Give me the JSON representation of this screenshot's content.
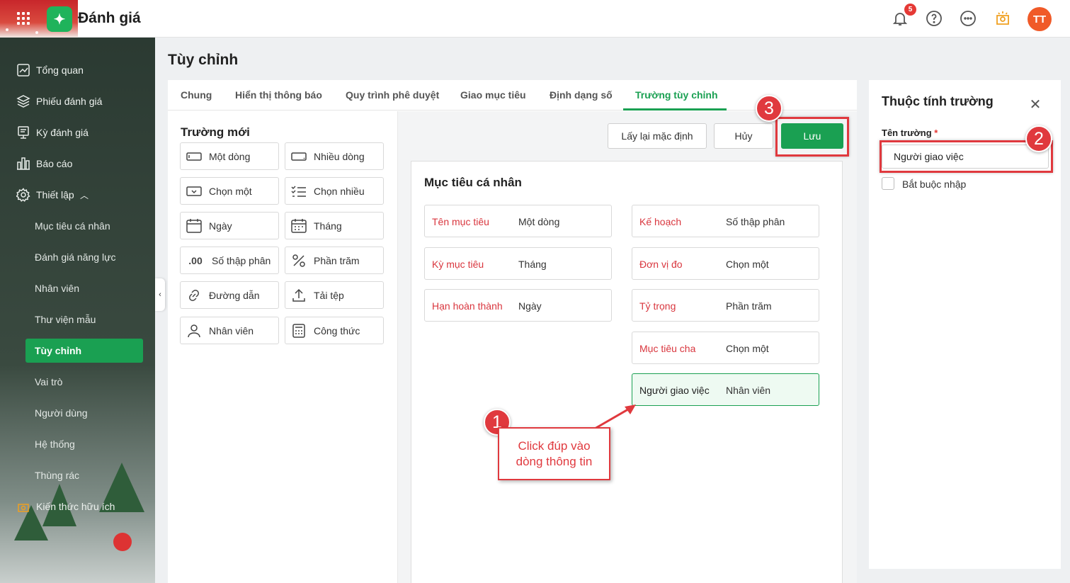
{
  "app": {
    "title": "Đánh giá"
  },
  "header": {
    "notification_count": "5",
    "avatar_initials": "TT"
  },
  "sidebar": {
    "items": [
      {
        "label": "Tổng quan",
        "icon": "chart-icon"
      },
      {
        "label": "Phiếu đánh giá",
        "icon": "layers-icon"
      },
      {
        "label": "Kỳ đánh giá",
        "icon": "period-icon"
      },
      {
        "label": "Báo cáo",
        "icon": "report-icon"
      },
      {
        "label": "Thiết lập",
        "icon": "gear-icon"
      }
    ],
    "sub_items": [
      {
        "label": "Mục tiêu cá nhân"
      },
      {
        "label": "Đánh giá năng lực"
      },
      {
        "label": "Nhân viên"
      },
      {
        "label": "Thư viện mẫu"
      },
      {
        "label": "Tùy chỉnh"
      },
      {
        "label": "Vai trò"
      },
      {
        "label": "Người dùng"
      },
      {
        "label": "Hệ thống"
      },
      {
        "label": "Thùng rác"
      }
    ],
    "bottom_label": "Kiến thức hữu ích"
  },
  "page": {
    "title": "Tùy chỉnh"
  },
  "tabs": [
    {
      "label": "Chung"
    },
    {
      "label": "Hiển thị thông báo"
    },
    {
      "label": "Quy trình phê duyệt"
    },
    {
      "label": "Giao mục tiêu"
    },
    {
      "label": "Định dạng số"
    },
    {
      "label": "Trường tùy chỉnh"
    }
  ],
  "new_fields": {
    "title": "Trường mới",
    "items": [
      {
        "label": "Một dòng",
        "icon": "single-line-icon"
      },
      {
        "label": "Nhiều dòng",
        "icon": "multi-line-icon"
      },
      {
        "label": "Chọn một",
        "icon": "dropdown-icon"
      },
      {
        "label": "Chọn nhiều",
        "icon": "checklist-icon"
      },
      {
        "label": "Ngày",
        "icon": "calendar-icon"
      },
      {
        "label": "Tháng",
        "icon": "calendar-month-icon"
      },
      {
        "label": "Số thập phân",
        "icon": "decimal-icon"
      },
      {
        "label": "Phần trăm",
        "icon": "percent-icon"
      },
      {
        "label": "Đường dẫn",
        "icon": "link-icon"
      },
      {
        "label": "Tải tệp",
        "icon": "upload-icon"
      },
      {
        "label": "Nhân viên",
        "icon": "person-icon"
      },
      {
        "label": "Công thức",
        "icon": "calculator-icon"
      }
    ]
  },
  "actions": {
    "reset": "Lấy lại mặc định",
    "cancel": "Hủy",
    "save": "Lưu"
  },
  "form": {
    "title": "Mục tiêu cá nhân",
    "left_rows": [
      {
        "label": "Tên mục tiêu",
        "type": "Một dòng"
      },
      {
        "label": "Kỳ mục tiêu",
        "type": "Tháng"
      },
      {
        "label": "Hạn hoàn thành",
        "type": "Ngày"
      }
    ],
    "right_rows": [
      {
        "label": "Kế hoạch",
        "type": "Số thập phân"
      },
      {
        "label": "Đơn vị đo",
        "type": "Chọn một"
      },
      {
        "label": "Tỷ trọng",
        "type": "Phần trăm"
      },
      {
        "label": "Mục tiêu cha",
        "type": "Chọn một"
      },
      {
        "label": "Người giao việc",
        "type": "Nhân viên"
      }
    ]
  },
  "properties": {
    "title": "Thuộc tính trường",
    "field_name_label": "Tên trường",
    "required_mark": "*",
    "field_name_value": "Người giao việc",
    "required_checkbox_label": "Bắt buộc nhập"
  },
  "annotations": {
    "step1": "1",
    "step2": "2",
    "step3": "3",
    "callout_line1": "Click đúp vào",
    "callout_line2": "dòng thông tin",
    "color": "#e0393e"
  },
  "colors": {
    "accent": "#1aa052",
    "required": "#d9363e"
  }
}
